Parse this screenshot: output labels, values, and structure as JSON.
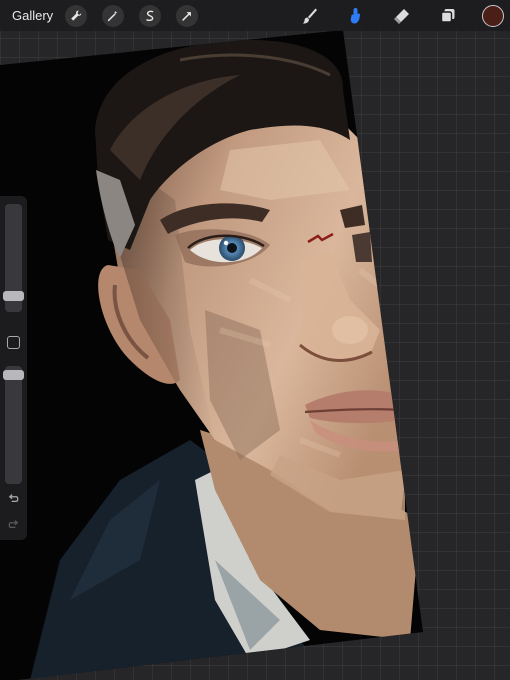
{
  "topbar": {
    "gallery_label": "Gallery",
    "left_tools": [
      "wrench-icon",
      "magic-wand-icon",
      "selection-icon",
      "transform-arrow-icon"
    ],
    "right_tools": [
      "brush-icon",
      "smudge-icon",
      "eraser-icon",
      "layers-icon"
    ],
    "active_tool": "smudge",
    "active_tool_color": "#2f7df6",
    "current_color": "#4a1f17"
  },
  "sidebar": {
    "brush_size_level": 0.82,
    "opacity_level": 0.03,
    "modify_button": "square-icon",
    "undo": "undo-icon",
    "redo": "redo-icon"
  },
  "canvas": {
    "content": "painting-portrait"
  }
}
